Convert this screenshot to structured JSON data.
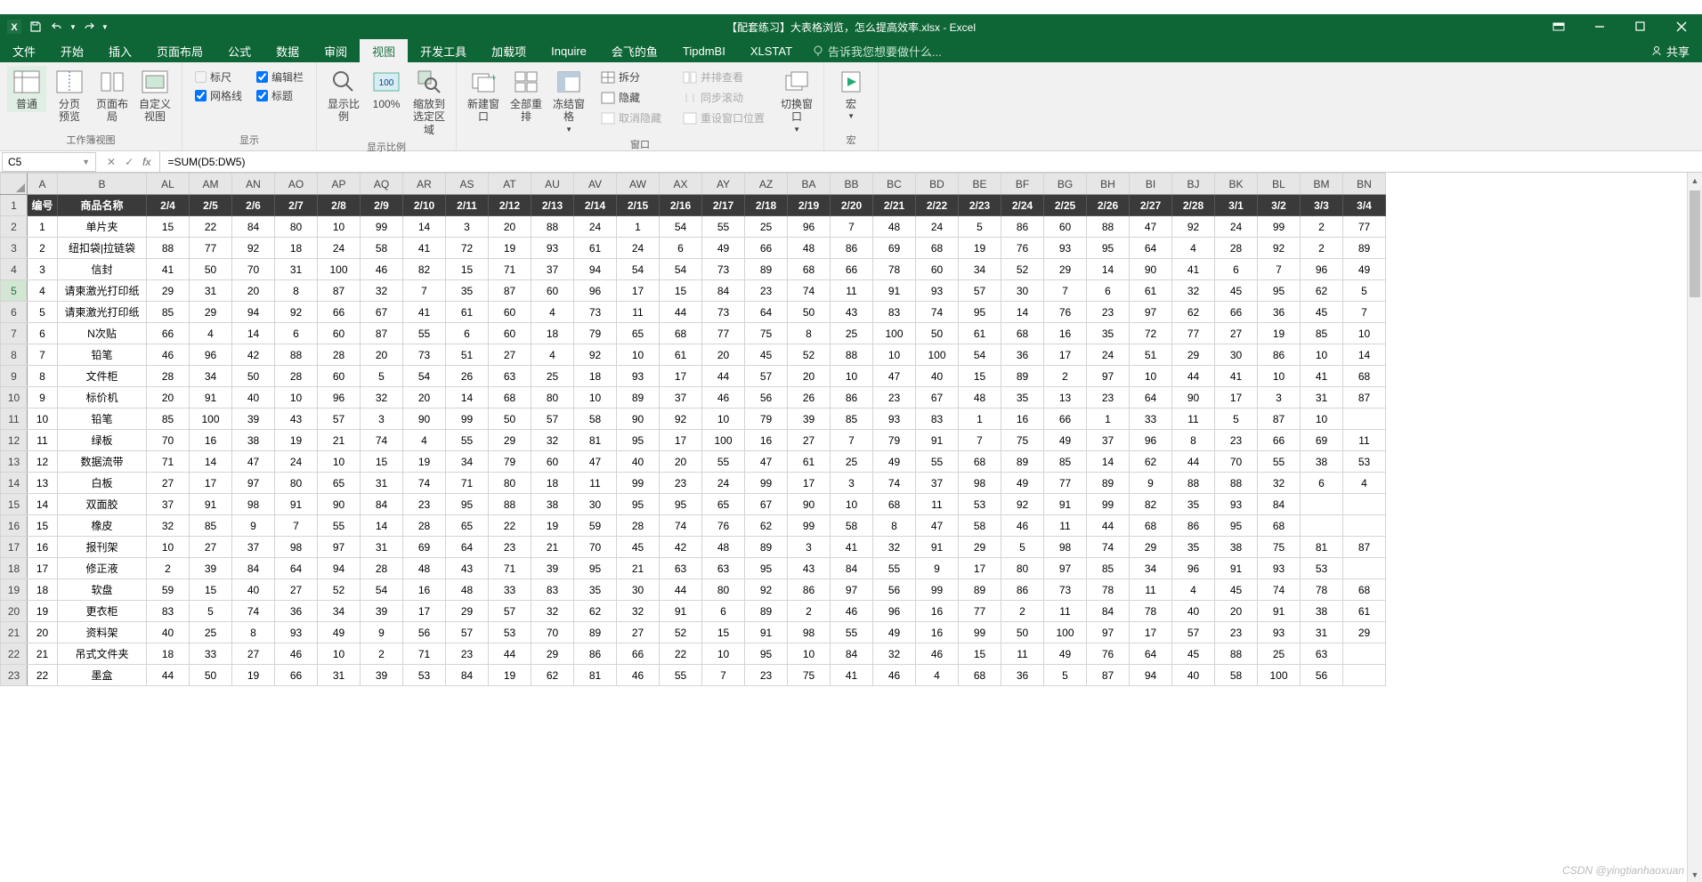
{
  "titlebar": {
    "doc_title": "【配套练习】大表格浏览，怎么提高效率.xlsx - Excel",
    "qat": {
      "save": "保存",
      "undo": "撤销",
      "redo": "重做"
    }
  },
  "tabs": {
    "items": [
      "文件",
      "开始",
      "插入",
      "页面布局",
      "公式",
      "数据",
      "审阅",
      "视图",
      "开发工具",
      "加载项",
      "Inquire",
      "会飞的鱼",
      "TipdmBI",
      "XLSTAT"
    ],
    "active_index": 7,
    "tellme": "告诉我您想要做什么...",
    "share": "共享"
  },
  "ribbon": {
    "workbook_views": {
      "label": "工作簿视图",
      "normal": "普通",
      "page_break": "分页\n预览",
      "page_layout": "页面布局",
      "custom": "自定义视图"
    },
    "show": {
      "label": "显示",
      "ruler": "标尺",
      "formula_bar": "编辑栏",
      "gridlines": "网格线",
      "headings": "标题"
    },
    "zoom": {
      "label": "显示比例",
      "zoom": "显示比例",
      "z100": "100%",
      "zoom_sel": "缩放到\n选定区域"
    },
    "window": {
      "label": "窗口",
      "new_win": "新建窗口",
      "arrange": "全部重排",
      "freeze": "冻结窗格",
      "split": "拆分",
      "hide": "隐藏",
      "unhide": "取消隐藏",
      "side": "并排查看",
      "sync": "同步滚动",
      "reset": "重设窗口位置",
      "switch": "切换窗口"
    },
    "macro": {
      "label": "宏",
      "macro": "宏"
    }
  },
  "formula_bar": {
    "name_box": "C5",
    "formula": "=SUM(D5:DW5)"
  },
  "sheet": {
    "col_letters": [
      "A",
      "B",
      "AL",
      "AM",
      "AN",
      "AO",
      "AP",
      "AQ",
      "AR",
      "AS",
      "AT",
      "AU",
      "AV",
      "AW",
      "AX",
      "AY",
      "AZ",
      "BA",
      "BB",
      "BC",
      "BD",
      "BE",
      "BF",
      "BG",
      "BH",
      "BI",
      "BJ",
      "BK",
      "BL",
      "BM",
      "BN"
    ],
    "header_row": [
      "编号",
      "商品名称",
      "2/4",
      "2/5",
      "2/6",
      "2/7",
      "2/8",
      "2/9",
      "2/10",
      "2/11",
      "2/12",
      "2/13",
      "2/14",
      "2/15",
      "2/16",
      "2/17",
      "2/18",
      "2/19",
      "2/20",
      "2/21",
      "2/22",
      "2/23",
      "2/24",
      "2/25",
      "2/26",
      "2/27",
      "2/28",
      "3/1",
      "3/2",
      "3/3",
      "3/4"
    ],
    "rows": [
      [
        "1",
        "单片夹",
        "15",
        "22",
        "84",
        "80",
        "10",
        "99",
        "14",
        "3",
        "20",
        "88",
        "24",
        "1",
        "54",
        "55",
        "25",
        "96",
        "7",
        "48",
        "24",
        "5",
        "86",
        "60",
        "88",
        "47",
        "92",
        "24",
        "99",
        "2",
        "77"
      ],
      [
        "2",
        "纽扣袋|拉链袋",
        "88",
        "77",
        "92",
        "18",
        "24",
        "58",
        "41",
        "72",
        "19",
        "93",
        "61",
        "24",
        "6",
        "49",
        "66",
        "48",
        "86",
        "69",
        "68",
        "19",
        "76",
        "93",
        "95",
        "64",
        "4",
        "28",
        "92",
        "2",
        "89"
      ],
      [
        "3",
        "信封",
        "41",
        "50",
        "70",
        "31",
        "100",
        "46",
        "82",
        "15",
        "71",
        "37",
        "94",
        "54",
        "54",
        "73",
        "89",
        "68",
        "66",
        "78",
        "60",
        "34",
        "52",
        "29",
        "14",
        "90",
        "41",
        "6",
        "7",
        "96",
        "49"
      ],
      [
        "4",
        "请柬激光打印纸",
        "29",
        "31",
        "20",
        "8",
        "87",
        "32",
        "7",
        "35",
        "87",
        "60",
        "96",
        "17",
        "15",
        "84",
        "23",
        "74",
        "11",
        "91",
        "93",
        "57",
        "30",
        "7",
        "6",
        "61",
        "32",
        "45",
        "95",
        "62",
        "5"
      ],
      [
        "5",
        "请柬激光打印纸",
        "85",
        "29",
        "94",
        "92",
        "66",
        "67",
        "41",
        "61",
        "60",
        "4",
        "73",
        "11",
        "44",
        "73",
        "64",
        "50",
        "43",
        "83",
        "74",
        "95",
        "14",
        "76",
        "23",
        "97",
        "62",
        "66",
        "36",
        "45",
        "7"
      ],
      [
        "6",
        "N次贴",
        "66",
        "4",
        "14",
        "6",
        "60",
        "87",
        "55",
        "6",
        "60",
        "18",
        "79",
        "65",
        "68",
        "77",
        "75",
        "8",
        "25",
        "100",
        "50",
        "61",
        "68",
        "16",
        "35",
        "72",
        "77",
        "27",
        "19",
        "85",
        "10"
      ],
      [
        "7",
        "铅笔",
        "46",
        "96",
        "42",
        "88",
        "28",
        "20",
        "73",
        "51",
        "27",
        "4",
        "92",
        "10",
        "61",
        "20",
        "45",
        "52",
        "88",
        "10",
        "100",
        "54",
        "36",
        "17",
        "24",
        "51",
        "29",
        "30",
        "86",
        "10",
        "14"
      ],
      [
        "8",
        "文件柜",
        "28",
        "34",
        "50",
        "28",
        "60",
        "5",
        "54",
        "26",
        "63",
        "25",
        "18",
        "93",
        "17",
        "44",
        "57",
        "20",
        "10",
        "47",
        "40",
        "15",
        "89",
        "2",
        "97",
        "10",
        "44",
        "41",
        "10",
        "41",
        "68"
      ],
      [
        "9",
        "标价机",
        "20",
        "91",
        "40",
        "10",
        "96",
        "32",
        "20",
        "14",
        "68",
        "80",
        "10",
        "89",
        "37",
        "46",
        "56",
        "26",
        "86",
        "23",
        "67",
        "48",
        "35",
        "13",
        "23",
        "64",
        "90",
        "17",
        "3",
        "31",
        "87"
      ],
      [
        "10",
        "铅笔",
        "85",
        "100",
        "39",
        "43",
        "57",
        "3",
        "90",
        "99",
        "50",
        "57",
        "58",
        "90",
        "92",
        "10",
        "79",
        "39",
        "85",
        "93",
        "83",
        "1",
        "16",
        "66",
        "1",
        "33",
        "11",
        "5",
        "87",
        "10"
      ],
      [
        "11",
        "绿板",
        "70",
        "16",
        "38",
        "19",
        "21",
        "74",
        "4",
        "55",
        "29",
        "32",
        "81",
        "95",
        "17",
        "100",
        "16",
        "27",
        "7",
        "79",
        "91",
        "7",
        "75",
        "49",
        "37",
        "96",
        "8",
        "23",
        "66",
        "69",
        "11"
      ],
      [
        "12",
        "数据流带",
        "71",
        "14",
        "47",
        "24",
        "10",
        "15",
        "19",
        "34",
        "79",
        "60",
        "47",
        "40",
        "20",
        "55",
        "47",
        "61",
        "25",
        "49",
        "55",
        "68",
        "89",
        "85",
        "14",
        "62",
        "44",
        "70",
        "55",
        "38",
        "53"
      ],
      [
        "13",
        "白板",
        "27",
        "17",
        "97",
        "80",
        "65",
        "31",
        "74",
        "71",
        "80",
        "18",
        "11",
        "99",
        "23",
        "24",
        "99",
        "17",
        "3",
        "74",
        "37",
        "98",
        "49",
        "77",
        "89",
        "9",
        "88",
        "88",
        "32",
        "6",
        "4"
      ],
      [
        "14",
        "双面胶",
        "37",
        "91",
        "98",
        "91",
        "90",
        "84",
        "23",
        "95",
        "88",
        "38",
        "30",
        "95",
        "95",
        "65",
        "67",
        "90",
        "10",
        "68",
        "11",
        "53",
        "92",
        "91",
        "99",
        "82",
        "35",
        "93",
        "84"
      ],
      [
        "15",
        "橡皮",
        "32",
        "85",
        "9",
        "7",
        "55",
        "14",
        "28",
        "65",
        "22",
        "19",
        "59",
        "28",
        "74",
        "76",
        "62",
        "99",
        "58",
        "8",
        "47",
        "58",
        "46",
        "11",
        "44",
        "68",
        "86",
        "95",
        "68"
      ],
      [
        "16",
        "报刊架",
        "10",
        "27",
        "37",
        "98",
        "97",
        "31",
        "69",
        "64",
        "23",
        "21",
        "70",
        "45",
        "42",
        "48",
        "89",
        "3",
        "41",
        "32",
        "91",
        "29",
        "5",
        "98",
        "74",
        "29",
        "35",
        "38",
        "75",
        "81",
        "87"
      ],
      [
        "17",
        "修正液",
        "2",
        "39",
        "84",
        "64",
        "94",
        "28",
        "48",
        "43",
        "71",
        "39",
        "95",
        "21",
        "63",
        "63",
        "95",
        "43",
        "84",
        "55",
        "9",
        "17",
        "80",
        "97",
        "85",
        "34",
        "96",
        "91",
        "93",
        "53"
      ],
      [
        "18",
        "软盘",
        "59",
        "15",
        "40",
        "27",
        "52",
        "54",
        "16",
        "48",
        "33",
        "83",
        "35",
        "30",
        "44",
        "80",
        "92",
        "86",
        "97",
        "56",
        "99",
        "89",
        "86",
        "73",
        "78",
        "11",
        "4",
        "45",
        "74",
        "78",
        "68"
      ],
      [
        "19",
        "更衣柜",
        "83",
        "5",
        "74",
        "36",
        "34",
        "39",
        "17",
        "29",
        "57",
        "32",
        "62",
        "32",
        "91",
        "6",
        "89",
        "2",
        "46",
        "96",
        "16",
        "77",
        "2",
        "11",
        "84",
        "78",
        "40",
        "20",
        "91",
        "38",
        "61"
      ],
      [
        "20",
        "资料架",
        "40",
        "25",
        "8",
        "93",
        "49",
        "9",
        "56",
        "57",
        "53",
        "70",
        "89",
        "27",
        "52",
        "15",
        "91",
        "98",
        "55",
        "49",
        "16",
        "99",
        "50",
        "100",
        "97",
        "17",
        "57",
        "23",
        "93",
        "31",
        "29"
      ],
      [
        "21",
        "吊式文件夹",
        "18",
        "33",
        "27",
        "46",
        "10",
        "2",
        "71",
        "23",
        "44",
        "29",
        "86",
        "66",
        "22",
        "10",
        "95",
        "10",
        "84",
        "32",
        "46",
        "15",
        "11",
        "49",
        "76",
        "64",
        "45",
        "88",
        "25",
        "63"
      ],
      [
        "22",
        "墨盒",
        "44",
        "50",
        "19",
        "66",
        "31",
        "39",
        "53",
        "84",
        "19",
        "62",
        "81",
        "46",
        "55",
        "7",
        "23",
        "75",
        "41",
        "46",
        "4",
        "68",
        "36",
        "5",
        "87",
        "94",
        "40",
        "58",
        "100",
        "56"
      ]
    ],
    "selected_cell_row": 3,
    "selected_col_header": "A",
    "selected_row_header": 4
  },
  "watermark": "CSDN @yingtianhaoxuan"
}
